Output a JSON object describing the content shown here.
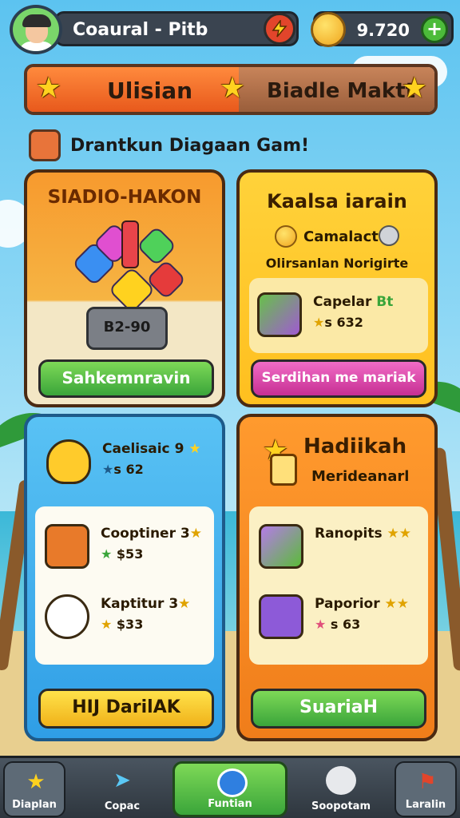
{
  "player": {
    "name": "Coaural - Pitb",
    "currency": "9.720"
  },
  "banner": {
    "left_tab": "Ulisian",
    "right_tab": "Biadle Maktt"
  },
  "subtitle": "Drantkun Diagaan Gam!",
  "card_gems": {
    "title": "SIADIO-HAKON",
    "price": "B2-90",
    "button": "Sahkemnravin"
  },
  "card_offer": {
    "title": "Kaalsa iarain",
    "coin_label": "Camalacte",
    "subline": "Olirsanlan Norigirte",
    "item_name": "Capelar",
    "item_badge": "Bt",
    "item_price": "632",
    "button": "Serdihan me mariak"
  },
  "card_items": {
    "top_name": "Caelisaic",
    "top_badge": "9",
    "top_price": "62",
    "items": [
      {
        "name": "Cooptiner",
        "badge": "3",
        "price": "$53"
      },
      {
        "name": "Kaptitur",
        "badge": "3",
        "price": "$33"
      }
    ],
    "button": "HIJ DarilAK"
  },
  "card_reward": {
    "title": "Hadiikah",
    "subtitle": "Merideanarl",
    "items": [
      {
        "name": "Ranopits",
        "price": ""
      },
      {
        "name": "Paporior",
        "price": "s 63"
      }
    ],
    "button": "SuariaH"
  },
  "nav": [
    {
      "label": "Diaplan",
      "icon": "star-icon"
    },
    {
      "label": "Copac",
      "icon": "plane-icon"
    },
    {
      "label": "Funtian",
      "icon": "circle-icon"
    },
    {
      "label": "Soopotam",
      "icon": "creature-icon"
    },
    {
      "label": "Laralin",
      "icon": "flag-icon"
    }
  ]
}
